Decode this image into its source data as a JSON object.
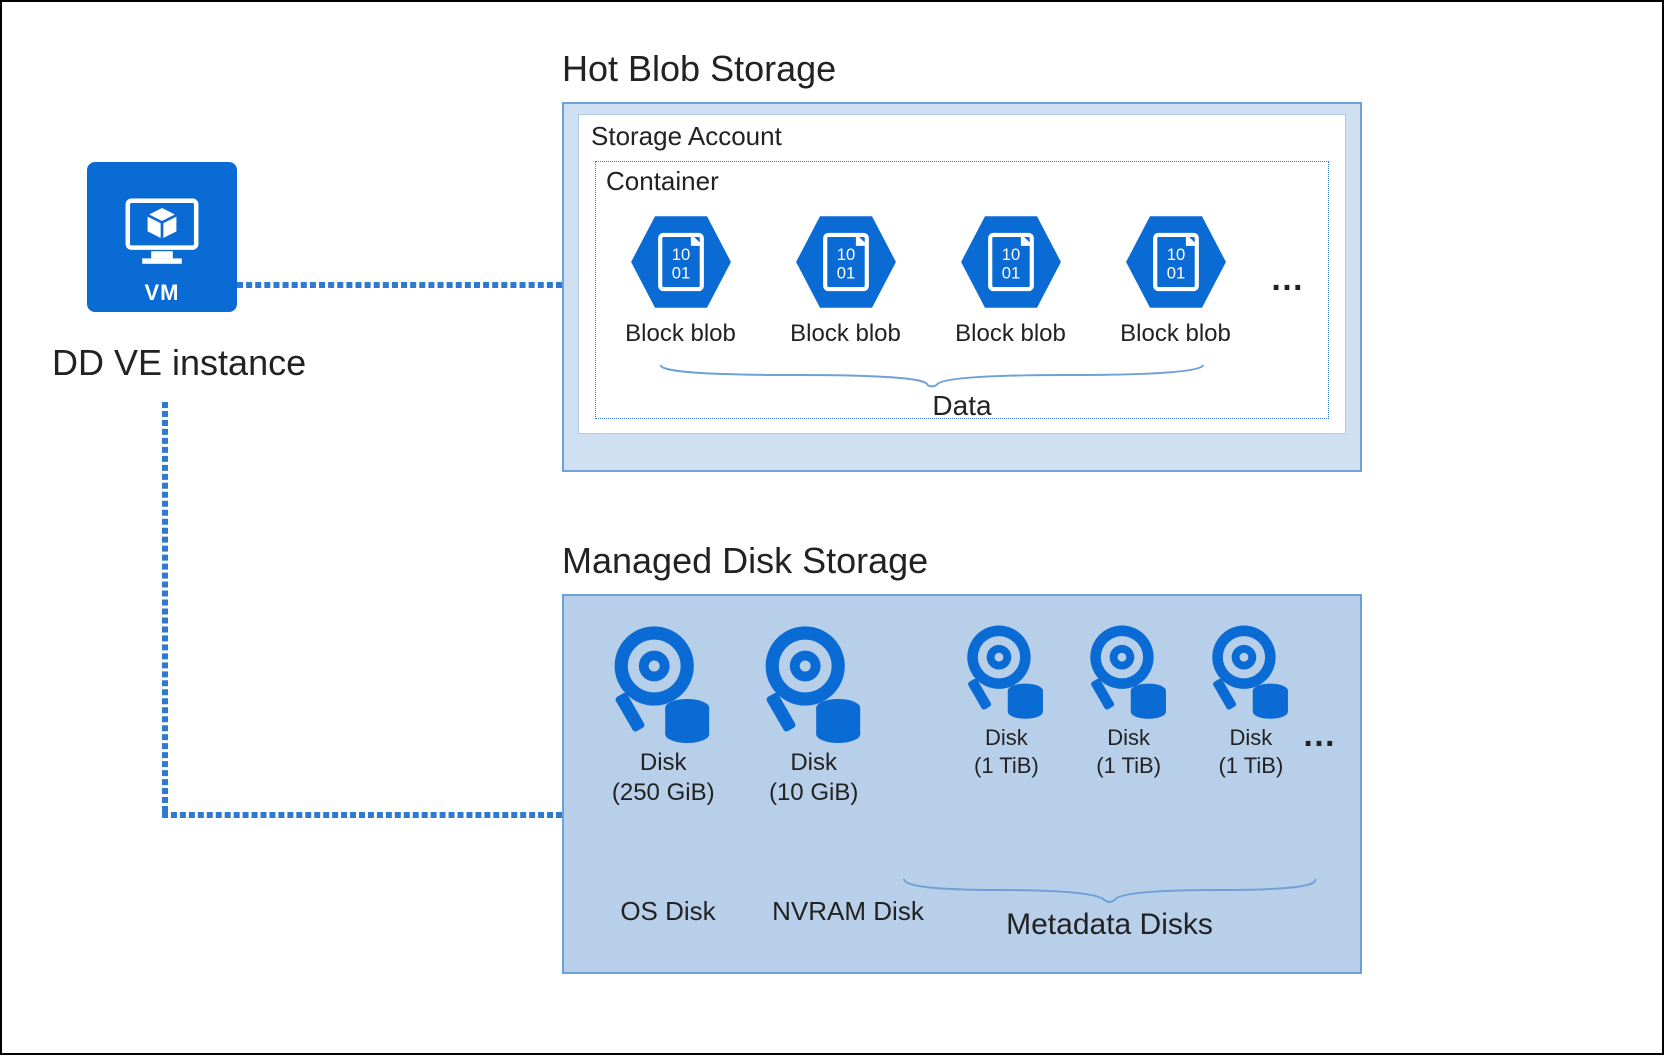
{
  "vm": {
    "caption": "VM",
    "instance_label": "DD VE instance"
  },
  "hot_blob": {
    "title": "Hot Blob Storage",
    "storage_account_label": "Storage Account",
    "container_label": "Container",
    "blob_value": "10\n01",
    "blob_item_label": "Block blob",
    "blob_count_shown": 4,
    "ellipsis": "…",
    "group_label": "Data"
  },
  "managed_disk": {
    "title": "Managed Disk Storage",
    "os_disk": {
      "label": "Disk",
      "size": "(250 GiB)",
      "role": "OS Disk"
    },
    "nvram_disk": {
      "label": "Disk",
      "size": "(10 GiB)",
      "role": "NVRAM Disk"
    },
    "metadata_disk": {
      "label": "Disk",
      "size": "(1 TiB)"
    },
    "metadata_count_shown": 3,
    "ellipsis": "…",
    "metadata_group_label": "Metadata Disks"
  },
  "colors": {
    "azure_blue": "#0b6bd4",
    "panel_light": "#cfe0f3",
    "panel_dark": "#b8cfea",
    "panel_border": "#6fa0d6",
    "connector": "#2f7ad0"
  }
}
